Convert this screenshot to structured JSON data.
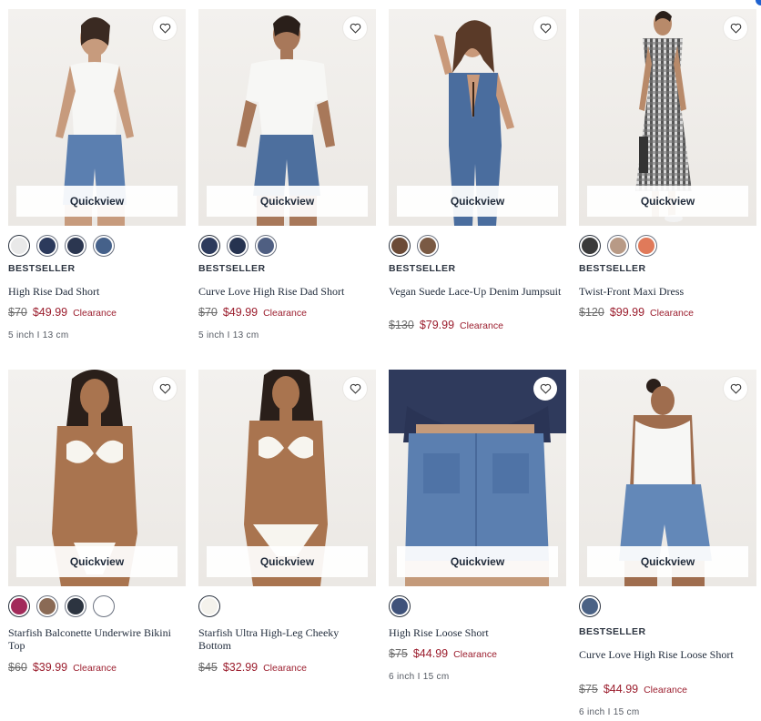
{
  "quickview_label": "Quickview",
  "products": [
    {
      "badge": "BESTSELLER",
      "name": "High Rise Dad Short",
      "orig_price": "$70",
      "sale_price": "$49.99",
      "clearance": "Clearance",
      "meta": "5 inch I 13 cm",
      "swatches": [
        "#e9e9e9",
        "#2c3a5c",
        "#2b3650",
        "#45618a"
      ]
    },
    {
      "badge": "BESTSELLER",
      "name": "Curve Love High Rise Dad Short",
      "orig_price": "$70",
      "sale_price": "$49.99",
      "clearance": "Clearance",
      "meta": "5 inch I 13 cm",
      "swatches": [
        "#2c3a5c",
        "#263350",
        "#4f5f82"
      ]
    },
    {
      "badge": "BESTSELLER",
      "name": "Vegan Suede Lace-Up Denim Jumpsuit",
      "orig_price": "$130",
      "sale_price": "$79.99",
      "clearance": "Clearance",
      "meta": "",
      "swatches": [
        "#6b4a36",
        "#7a5a44"
      ]
    },
    {
      "badge": "BESTSELLER",
      "name": "Twist-Front Maxi Dress",
      "orig_price": "$120",
      "sale_price": "$99.99",
      "clearance": "Clearance",
      "meta": "",
      "swatches": [
        "#3a3a3a",
        "#b89a86",
        "#e07a5a"
      ]
    },
    {
      "badge": "",
      "name": "Starfish Balconette Underwire Bikini Top",
      "orig_price": "$60",
      "sale_price": "$39.99",
      "clearance": "Clearance",
      "meta": "",
      "swatches": [
        "#a22a5a",
        "#8a6a55",
        "#2c3440",
        "#ffffff"
      ]
    },
    {
      "badge": "",
      "name": "Starfish Ultra High-Leg Cheeky Bottom",
      "orig_price": "$45",
      "sale_price": "$32.99",
      "clearance": "Clearance",
      "meta": "",
      "swatches": [
        "#f4f2ec"
      ]
    },
    {
      "badge": "",
      "name": "High Rise Loose Short",
      "orig_price": "$75",
      "sale_price": "$44.99",
      "clearance": "Clearance",
      "meta": "6 inch I 15 cm",
      "swatches": [
        "#3f527a"
      ]
    },
    {
      "badge": "BESTSELLER",
      "name": "Curve Love High Rise Loose Short",
      "orig_price": "$75",
      "sale_price": "$44.99",
      "clearance": "Clearance",
      "meta": "6 inch I 15 cm",
      "swatches": [
        "#4a6285"
      ]
    }
  ],
  "colors": {
    "sale": "#9b1d2d",
    "text": "#1f2a3a",
    "quickview_bg": "#ffffff"
  },
  "icons": {
    "favorite": "heart-icon"
  }
}
